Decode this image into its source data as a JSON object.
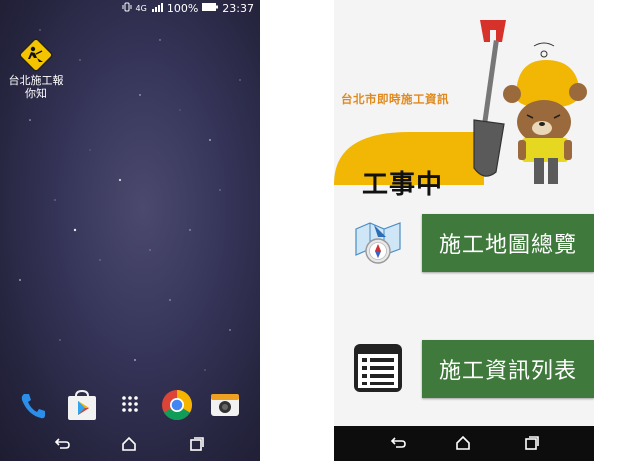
{
  "home": {
    "status": {
      "network": "4G",
      "battery": "100%",
      "time": "23:37"
    },
    "app_icon": {
      "label": "台北施工報你知",
      "icon": "construction-worker-sign-icon"
    },
    "dock": [
      {
        "name": "phone-app",
        "icon": "phone-icon"
      },
      {
        "name": "play-store-app",
        "icon": "play-store-icon"
      },
      {
        "name": "app-drawer",
        "icon": "app-drawer-icon"
      },
      {
        "name": "chrome-app",
        "icon": "chrome-icon"
      },
      {
        "name": "camera-app",
        "icon": "camera-icon"
      }
    ],
    "nav": [
      "back-icon",
      "home-icon",
      "recents-icon"
    ]
  },
  "app": {
    "banner": {
      "title": "台北市即時施工資訊",
      "sign_text": "工事中"
    },
    "menu": [
      {
        "label": "施工地圖總覽",
        "icon": "map-compass-icon"
      },
      {
        "label": "施工資訊列表",
        "icon": "list-icon"
      }
    ],
    "colors": {
      "button": "#3f7a3c",
      "accent": "#e08a1e",
      "helmet": "#f2b705"
    },
    "nav": [
      "back-icon",
      "home-icon",
      "recents-icon"
    ]
  }
}
